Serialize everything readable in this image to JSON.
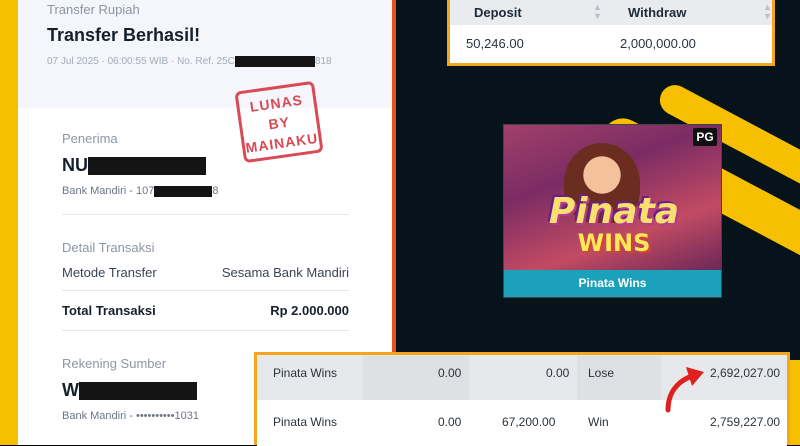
{
  "receipt": {
    "header_label": "Transfer Rupiah",
    "title": "Transfer Berhasil!",
    "meta_prefix": "07 Jul 2025 · 06:00:55 WIB · No. Ref. 25C",
    "meta_suffix": "818",
    "stamp_lines": [
      "LUNAS",
      "BY",
      "MAINAKU"
    ],
    "recipient": {
      "label": "Penerima",
      "name_visible": "NU",
      "bank_prefix": "Bank Mandiri - 107",
      "bank_suffix": "8"
    },
    "details": {
      "label": "Detail Transaksi",
      "method_label": "Metode Transfer",
      "method_value": "Sesama Bank Mandiri",
      "total_label": "Total Transaksi",
      "total_value": "Rp 2.000.000"
    },
    "source": {
      "label": "Rekening Sumber",
      "name_visible": "W",
      "bank": "Bank Mandiri - ••••••••••1031"
    }
  },
  "deposit_withdraw": {
    "headers": [
      "Deposit",
      "Withdraw"
    ],
    "values": [
      "50,246.00",
      "2,000,000.00"
    ]
  },
  "game": {
    "title_line1": "Pinata",
    "title_line2": "WINS",
    "provider_badge": "PG",
    "caption": "Pinata Wins"
  },
  "bets": [
    {
      "game": "Pinata Wins",
      "bet": "0.00",
      "payout": "0.00",
      "result": "Lose",
      "balance": "2,692,027.00"
    },
    {
      "game": "Pinata Wins",
      "bet": "0.00",
      "payout": "67,200.00",
      "result": "Win",
      "balance": "2,759,227.00"
    }
  ],
  "colors": {
    "yellow": "#f6c000",
    "orange_frame": "#f4a71c",
    "stamp_red": "#d94a55",
    "caption_teal": "#1ba1b9",
    "arrow_red": "#e0201e"
  }
}
